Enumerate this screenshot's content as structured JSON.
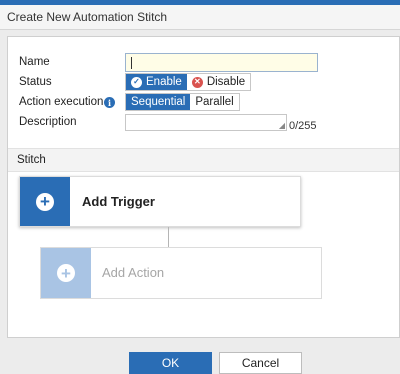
{
  "dialog": {
    "title": "Create New Automation Stitch"
  },
  "form": {
    "name_label": "Name",
    "name_value": "",
    "status_label": "Status",
    "status_options": [
      "Enable",
      "Disable"
    ],
    "status_selected": "Enable",
    "action_exec_label": "Action execution",
    "action_exec_options": [
      "Sequential",
      "Parallel"
    ],
    "action_exec_selected": "Sequential",
    "description_label": "Description",
    "description_value": "",
    "description_counter": "0/255"
  },
  "stitch": {
    "section_title": "Stitch",
    "trigger_label": "Add Trigger",
    "action_label": "Add Action"
  },
  "buttons": {
    "ok": "OK",
    "cancel": "Cancel"
  },
  "colors": {
    "accent": "#2a6db5",
    "accent_light": "#a9c4e4",
    "input_highlight": "#fffde7",
    "danger": "#d9534f"
  },
  "icons": [
    "check-icon",
    "x-circle-icon",
    "info-icon",
    "plus-icon",
    "resize-handle-icon"
  ]
}
